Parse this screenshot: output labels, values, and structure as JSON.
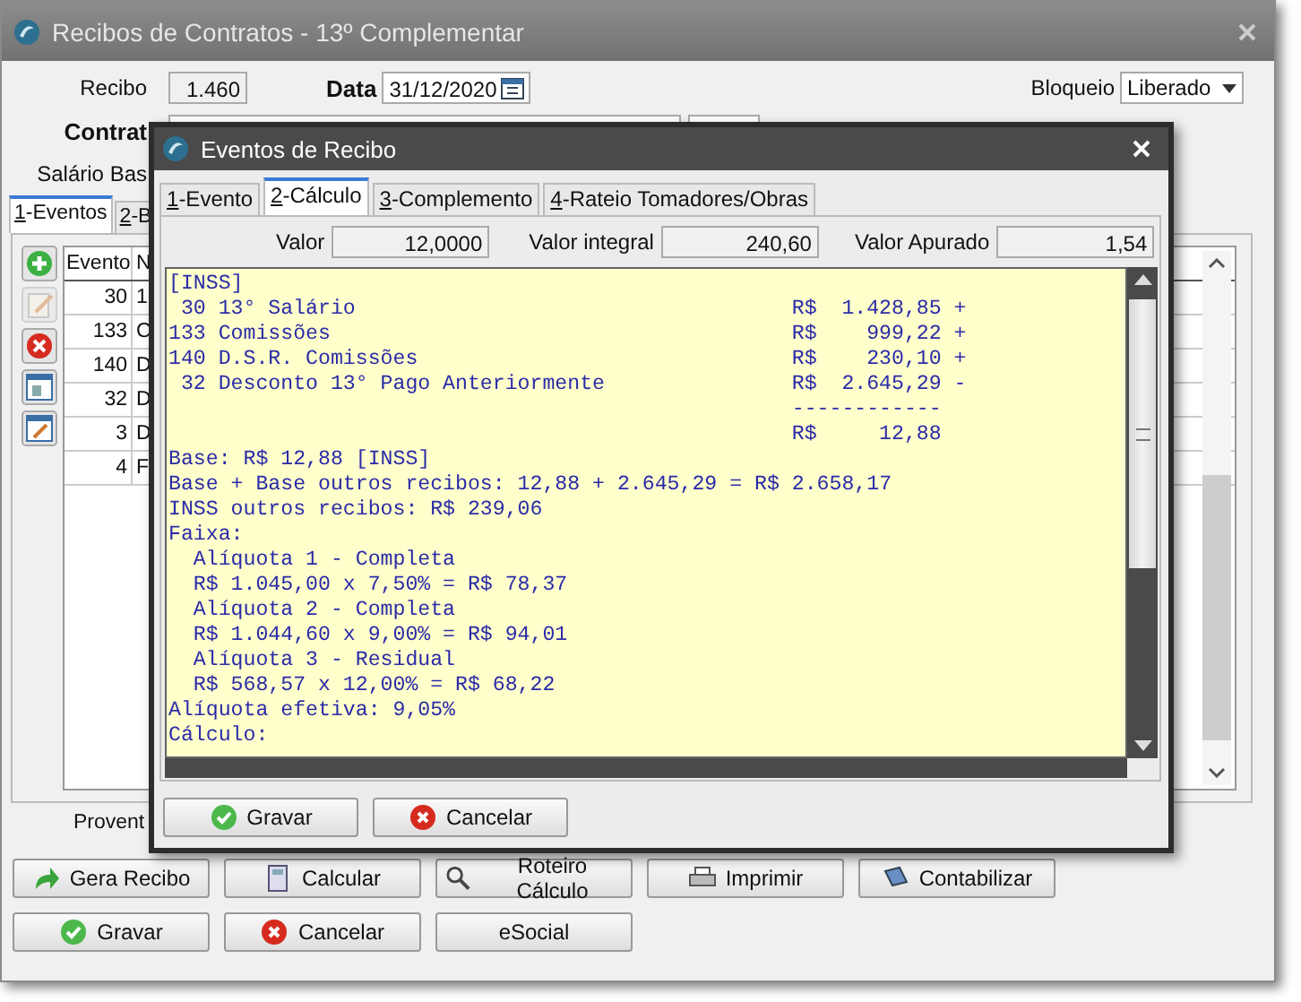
{
  "window": {
    "title": "Recibos de Contratos - 13º Complementar"
  },
  "form": {
    "recibo_label": "Recibo",
    "recibo": "1.460",
    "data_label": "Data",
    "data": "31/12/2020",
    "bloqueio_label": "Bloqueio",
    "bloqueio": "Liberado",
    "contrato_label": "Contrat",
    "salario_label": "Salário Bas"
  },
  "tabs": [
    {
      "label": "1-Eventos",
      "selected": true
    },
    {
      "label": "2-B",
      "selected": false
    }
  ],
  "toolbar": [
    {
      "kind": "add",
      "disabled": false
    },
    {
      "kind": "edit",
      "disabled": true
    },
    {
      "kind": "delete",
      "disabled": false
    },
    {
      "kind": "window",
      "disabled": false
    },
    {
      "kind": "edit-window",
      "disabled": false
    }
  ],
  "event_table": {
    "columns": [
      "Evento",
      "N"
    ],
    "rows": [
      {
        "evento": "30",
        "column_2": "1"
      },
      {
        "evento": "133",
        "column_2": "C"
      },
      {
        "evento": "140",
        "column_2": "D"
      },
      {
        "evento": "32",
        "column_2": "D"
      },
      {
        "evento": "3",
        "column_2": "D"
      },
      {
        "evento": "4",
        "column_2": "F"
      }
    ]
  },
  "proventos_label": "Provent",
  "action_buttons": [
    {
      "label": "Gera Recibo",
      "kind": "forward"
    },
    {
      "label": "Calcular",
      "kind": "calculator"
    },
    {
      "label": "Roteiro Cálculo",
      "kind": "search"
    },
    {
      "label": "Imprimir",
      "kind": "print"
    },
    {
      "label": "Contabilizar",
      "kind": "book"
    }
  ],
  "buttons": [
    {
      "label": "Gravar",
      "kind": "save"
    },
    {
      "label": "Cancelar",
      "kind": "cancel"
    },
    {
      "label": "eSocial",
      "kind": "plain"
    }
  ],
  "dialog": {
    "title": "Eventos de Recibo",
    "tabs": [
      {
        "label": "1-Evento",
        "selected": false
      },
      {
        "label": "2-Cálculo",
        "selected": true
      },
      {
        "label": "3-Complemento",
        "selected": false
      },
      {
        "label": "4-Rateio Tomadores/Obras",
        "selected": false
      }
    ],
    "fields": [
      {
        "label": "Valor",
        "value": "12,0000"
      },
      {
        "label": "Valor integral",
        "value": "240,60"
      },
      {
        "label": "Valor Apurado",
        "value": "1,54"
      }
    ],
    "memo": [
      {
        "kind": "text",
        "text": "[INSS]"
      },
      {
        "kind": "entry",
        "label": " 30 13° Salário",
        "value": "R$  1.428,85 +"
      },
      {
        "kind": "entry",
        "label": "133 Comissões",
        "value": "R$    999,22 +"
      },
      {
        "kind": "entry",
        "label": "140 D.S.R. Comissões",
        "value": "R$    230,10 +"
      },
      {
        "kind": "entry",
        "label": " 32 Desconto 13° Pago Anteriormente",
        "value": "R$  2.645,29 -"
      },
      {
        "kind": "column",
        "value": "------------"
      },
      {
        "kind": "column",
        "value": "R$     12,88"
      },
      {
        "kind": "text",
        "text": "Base: R$ 12,88 [INSS]"
      },
      {
        "kind": "text",
        "text": "Base + Base outros recibos: 12,88 + 2.645,29 = R$ 2.658,17"
      },
      {
        "kind": "text",
        "text": "INSS outros recibos: R$ 239,06"
      },
      {
        "kind": "text",
        "text": "Faixa:"
      },
      {
        "kind": "text",
        "text": "  Alíquota 1 - Completa"
      },
      {
        "kind": "text",
        "text": "  R$ 1.045,00 x 7,50% = R$ 78,37"
      },
      {
        "kind": "text",
        "text": "  Alíquota 2 - Completa"
      },
      {
        "kind": "text",
        "text": "  R$ 1.044,60 x 9,00% = R$ 94,01"
      },
      {
        "kind": "text",
        "text": "  Alíquota 3 - Residual"
      },
      {
        "kind": "text",
        "text": "  R$ 568,57 x 12,00% = R$ 68,22"
      },
      {
        "kind": "text",
        "text": "Alíquota efetiva: 9,05%"
      },
      {
        "kind": "text",
        "text": "Cálculo:"
      }
    ],
    "buttons": [
      {
        "label": "Gravar",
        "kind": "save"
      },
      {
        "label": "Cancelar",
        "kind": "cancel"
      }
    ]
  }
}
